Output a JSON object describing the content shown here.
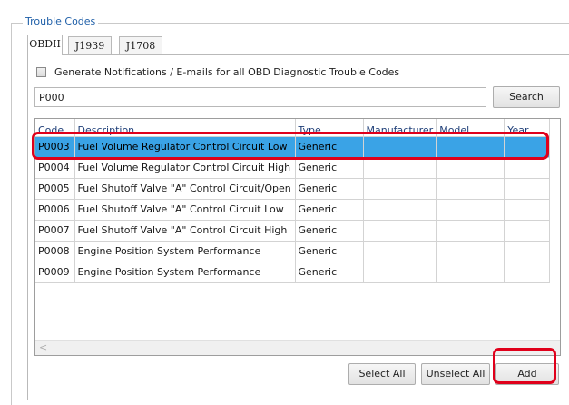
{
  "group_title": "Trouble Codes",
  "tabs": [
    {
      "label": "OBDII",
      "active": true
    },
    {
      "label": "J1939",
      "active": false
    },
    {
      "label": "J1708",
      "active": false
    }
  ],
  "notify_checkbox": {
    "label": "Generate Notifications / E-mails for all OBD Diagnostic Trouble Codes",
    "checked": false
  },
  "search": {
    "value": "P000",
    "button_label": "Search"
  },
  "table": {
    "columns": [
      "Code",
      "Description",
      "Type",
      "Manufacturer",
      "Model",
      "Year"
    ],
    "rows": [
      {
        "code": "P0003",
        "description": "Fuel Volume Regulator Control Circuit Low",
        "type": "Generic",
        "manufacturer": "",
        "model": "",
        "year": "",
        "selected": true
      },
      {
        "code": "P0004",
        "description": "Fuel Volume Regulator Control Circuit High",
        "type": "Generic",
        "manufacturer": "",
        "model": "",
        "year": ""
      },
      {
        "code": "P0005",
        "description": "Fuel Shutoff Valve \"A\" Control Circuit/Open",
        "type": "Generic",
        "manufacturer": "",
        "model": "",
        "year": ""
      },
      {
        "code": "P0006",
        "description": "Fuel Shutoff Valve \"A\" Control Circuit Low",
        "type": "Generic",
        "manufacturer": "",
        "model": "",
        "year": ""
      },
      {
        "code": "P0007",
        "description": "Fuel Shutoff Valve \"A\" Control Circuit High",
        "type": "Generic",
        "manufacturer": "",
        "model": "",
        "year": ""
      },
      {
        "code": "P0008",
        "description": "Engine Position System Performance",
        "type": "Generic",
        "manufacturer": "",
        "model": "",
        "year": ""
      },
      {
        "code": "P0009",
        "description": "Engine Position System Performance",
        "type": "Generic",
        "manufacturer": "",
        "model": "",
        "year": ""
      }
    ]
  },
  "scroll_arrow": "<",
  "buttons": {
    "select_all": "Select All",
    "unselect_all": "Unselect All",
    "add": "Add"
  },
  "colors": {
    "selection": "#3aa3e6",
    "highlight": "#e0001b",
    "group_title": "#1f5fa8"
  }
}
